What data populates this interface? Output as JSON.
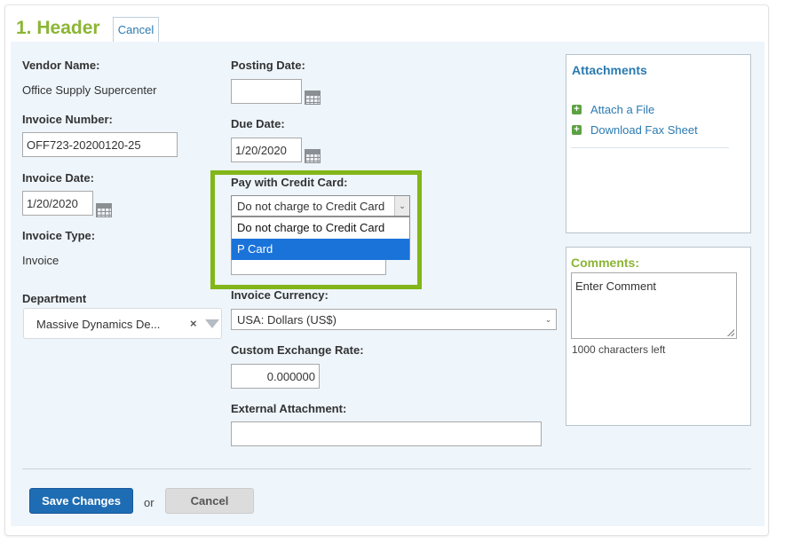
{
  "header": {
    "title": "1. Header",
    "cancel_label": "Cancel"
  },
  "vendor": {
    "label": "Vendor Name:",
    "value": "Office Supply Supercenter"
  },
  "invoice_number": {
    "label": "Invoice Number:",
    "value": "OFF723-20200120-25"
  },
  "invoice_date": {
    "label": "Invoice Date:",
    "value": "1/20/2020"
  },
  "invoice_type": {
    "label": "Invoice Type:",
    "value": "Invoice"
  },
  "department": {
    "label": "Department",
    "value": "Massive Dynamics De...",
    "clear": "×"
  },
  "posting_date": {
    "label": "Posting Date:",
    "value": ""
  },
  "due_date": {
    "label": "Due Date:",
    "value": "1/20/2020"
  },
  "credit_card": {
    "label": "Pay with Credit Card:",
    "selected": "Do not charge to Credit Card",
    "options": [
      "Do not charge to Credit Card",
      "P Card"
    ],
    "highlighted_option": "P Card"
  },
  "currency": {
    "label": "Invoice Currency:",
    "value": "USA: Dollars (US$)"
  },
  "exchange_rate": {
    "label": "Custom Exchange Rate:",
    "value": "0.000000"
  },
  "external_attachment": {
    "label": "External Attachment:",
    "value": ""
  },
  "attachments": {
    "title": "Attachments",
    "links": [
      "Attach a File",
      "Download Fax Sheet"
    ]
  },
  "comments": {
    "title": "Comments:",
    "placeholder": "Enter Comment",
    "chars_left": "1000 characters left"
  },
  "footer": {
    "save_label": "Save Changes",
    "or_text": "or",
    "cancel_label": "Cancel"
  },
  "colors": {
    "accent_green": "#8cb535",
    "link_blue": "#2a7ab0",
    "primary_button": "#1e6db4",
    "highlight_border": "#82b619"
  }
}
